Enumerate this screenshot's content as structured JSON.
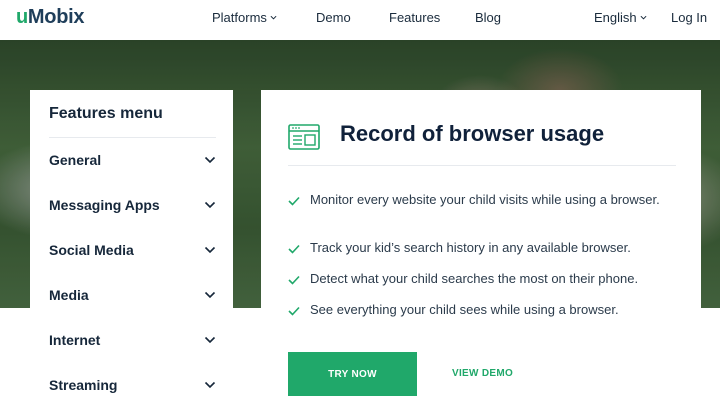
{
  "brand": {
    "logo_prefix": "u",
    "logo_rest": "Mobix"
  },
  "nav": {
    "items": [
      {
        "label": "Platforms",
        "has_caret": true
      },
      {
        "label": "Demo",
        "has_caret": false
      },
      {
        "label": "Features",
        "has_caret": false
      },
      {
        "label": "Blog",
        "has_caret": false
      }
    ],
    "language": "English",
    "login": "Log In"
  },
  "menu": {
    "title": "Features menu",
    "items": [
      {
        "label": "General"
      },
      {
        "label": "Messaging Apps"
      },
      {
        "label": "Social Media"
      },
      {
        "label": "Media"
      },
      {
        "label": "Internet"
      },
      {
        "label": "Streaming"
      }
    ]
  },
  "card": {
    "title": "Record of browser usage",
    "icon": "browser-window-icon",
    "features": [
      "Monitor every website your child visits while using a browser.",
      "Track your kid’s search history in any available browser.",
      "Detect what your child searches the most on their phone.",
      "See everything your child sees while using a browser."
    ],
    "try_label": "TRY NOW",
    "demo_label": "VIEW DEMO"
  },
  "colors": {
    "accent": "#20a86a",
    "text_dark": "#16273a"
  }
}
